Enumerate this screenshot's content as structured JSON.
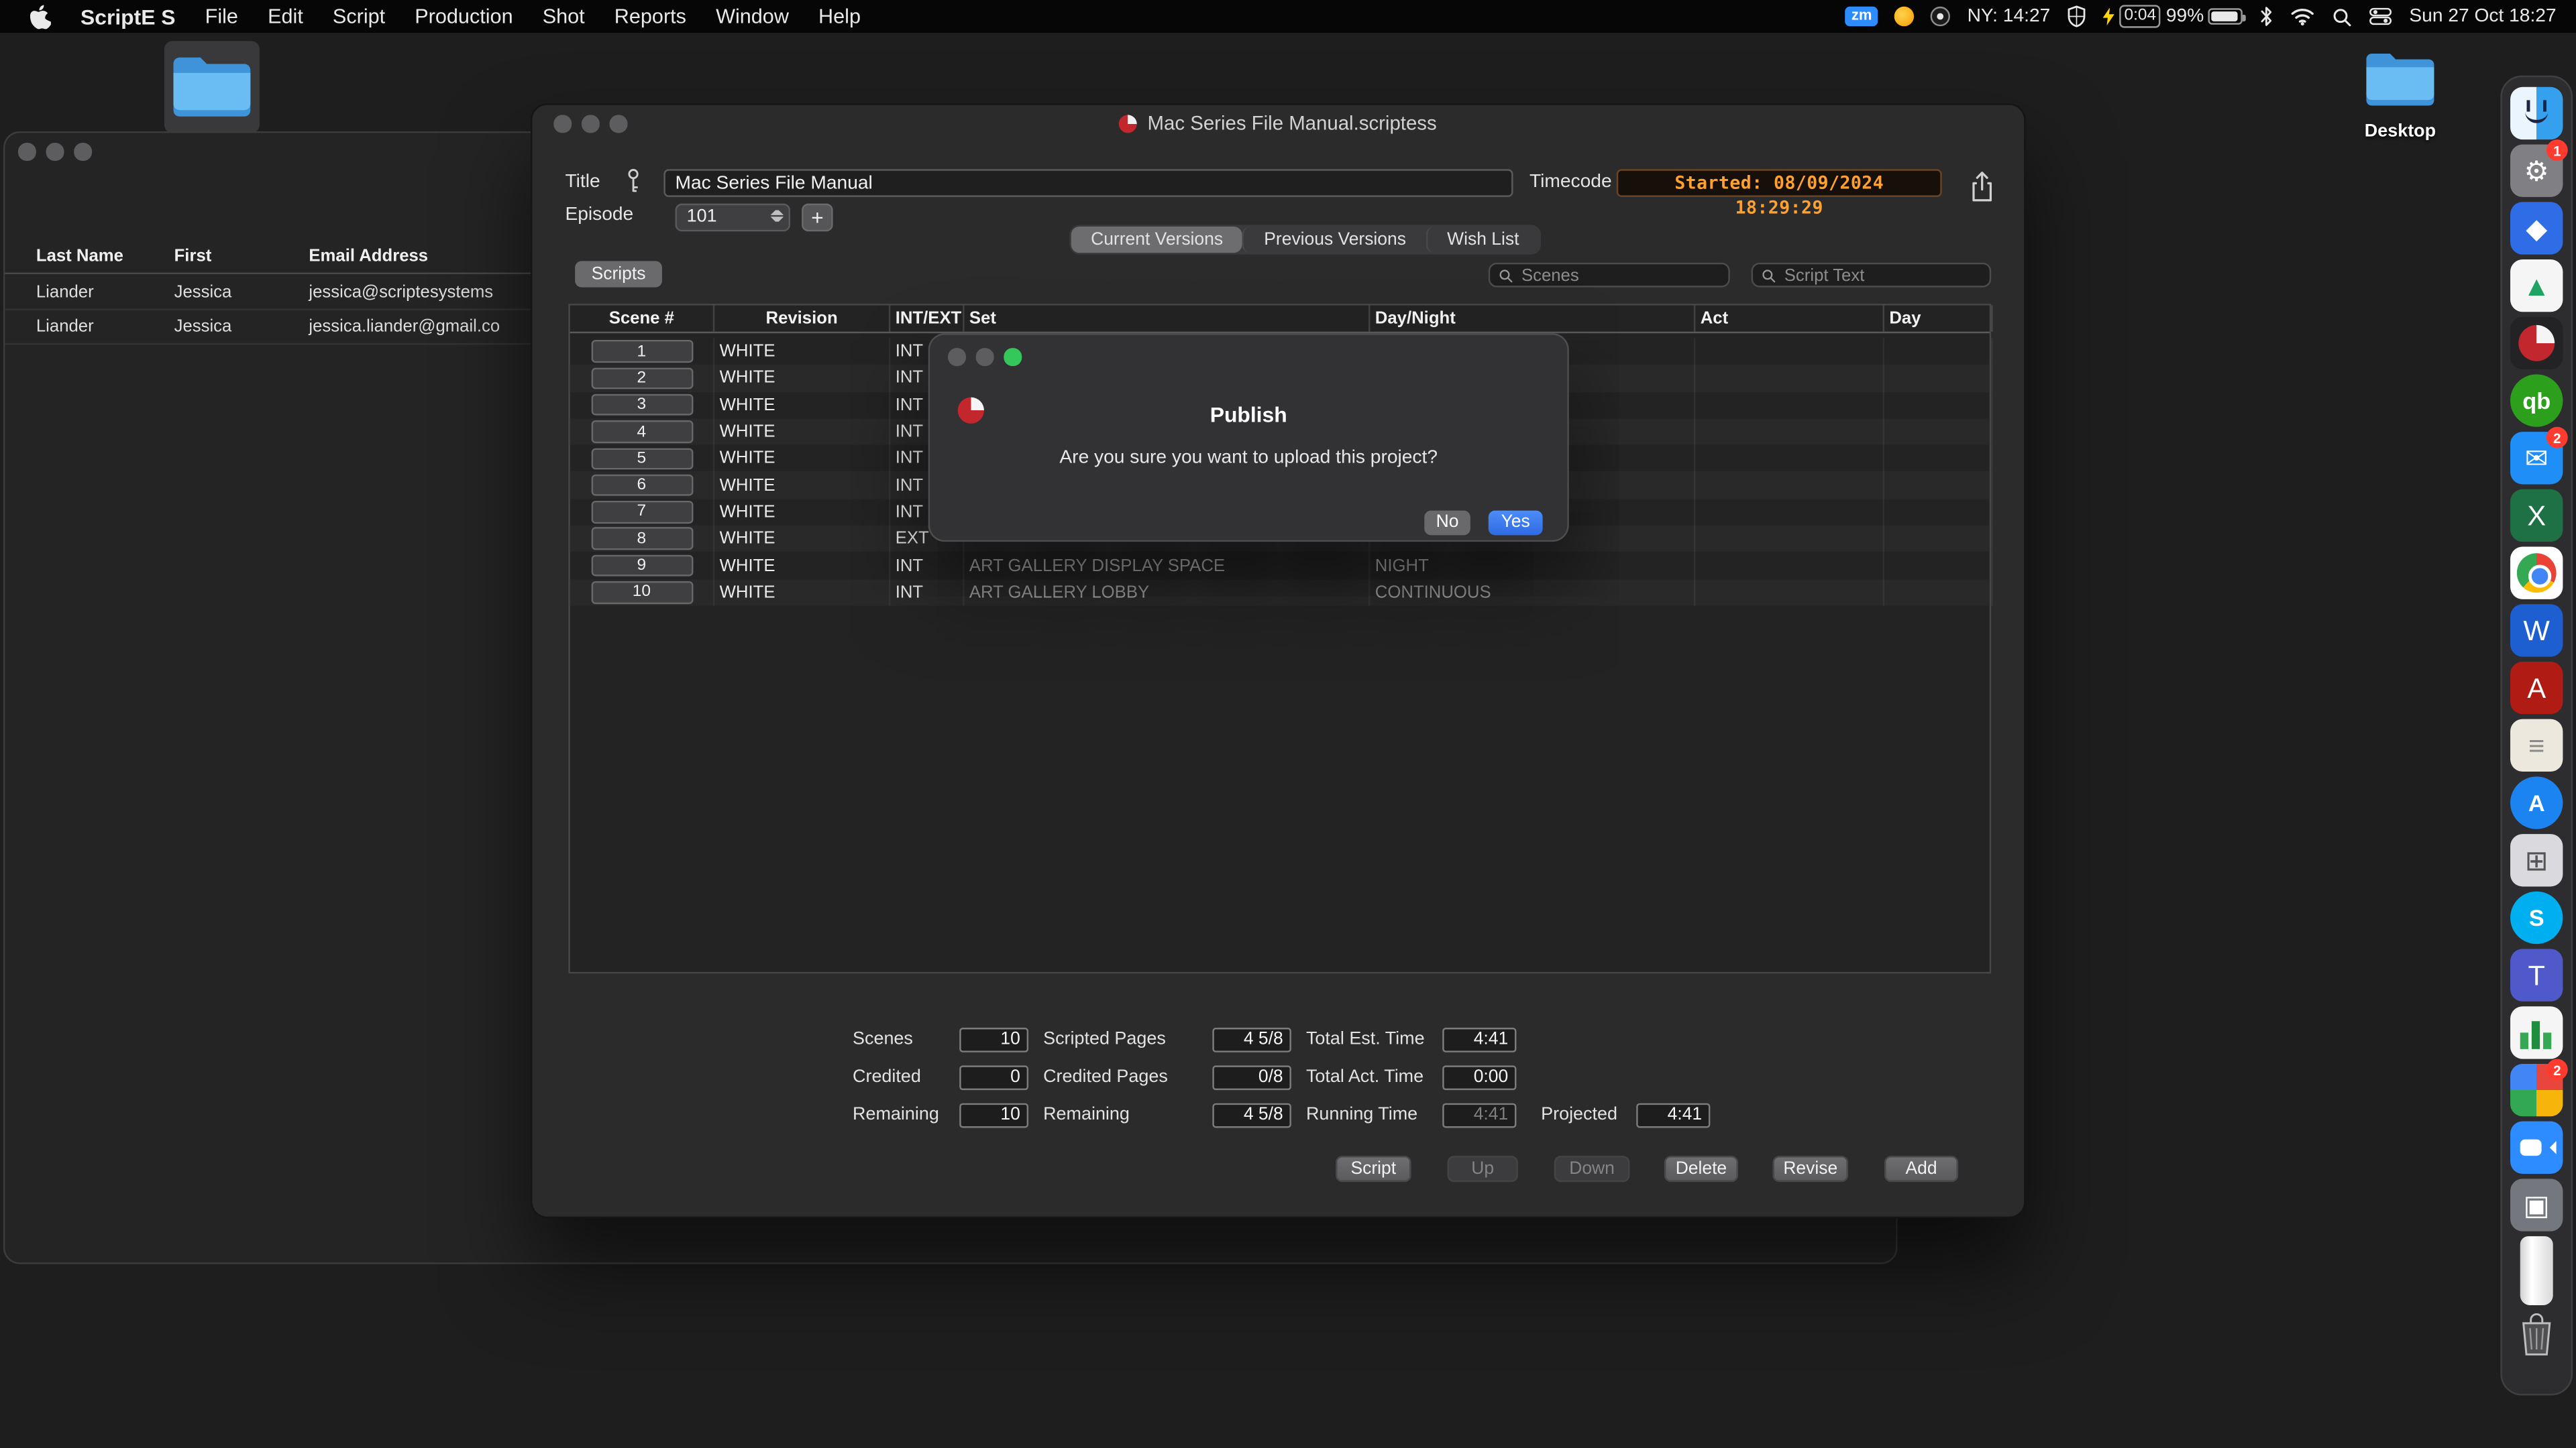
{
  "menu_bar": {
    "app_name": "ScriptE S",
    "menus": [
      "File",
      "Edit",
      "Script",
      "Production",
      "Shot",
      "Reports",
      "Window",
      "Help"
    ],
    "status": {
      "zoom_badge": "zm",
      "ny_time": "NY: 14:27",
      "battery_time": "0:04",
      "battery_percent": "99%",
      "clock": "Sun 27 Oct 18:27"
    }
  },
  "desktop": {
    "desktop_folder_label": "Desktop"
  },
  "contacts_window": {
    "columns": [
      "Last Name",
      "First",
      "Email Address"
    ],
    "rows": [
      {
        "last_name": "Liander",
        "first": "Jessica",
        "email": "jessica@scriptesystems"
      },
      {
        "last_name": "Liander",
        "first": "Jessica",
        "email": "jessica.liander@gmail.co"
      }
    ]
  },
  "main_window": {
    "window_title": "Mac Series File Manual.scriptess",
    "title_label": "Title",
    "title_value": "Mac Series File Manual",
    "timecode_label": "Timecode",
    "timecode_value": "Started: 08/09/2024 18:29:29",
    "episode_label": "Episode",
    "episode_value": "101",
    "add_episode_label": "+",
    "scripts_tab_label": "Scripts",
    "search_scenes_placeholder": "Scenes",
    "search_text_placeholder": "Script Text",
    "tabs": [
      {
        "label": "Current Versions",
        "selected": true
      },
      {
        "label": "Previous Versions",
        "selected": false
      },
      {
        "label": "Wish List",
        "selected": false
      }
    ],
    "table": {
      "columns": [
        "Scene #",
        "Revision",
        "INT/EXT",
        "Set",
        "Day/Night",
        "Act",
        "Day"
      ],
      "rows": [
        {
          "scene": "1",
          "revision": "WHITE",
          "int_ext": "INT",
          "set": "",
          "day_night": "",
          "act": "",
          "day": ""
        },
        {
          "scene": "2",
          "revision": "WHITE",
          "int_ext": "INT",
          "set": "",
          "day_night": "",
          "act": "",
          "day": ""
        },
        {
          "scene": "3",
          "revision": "WHITE",
          "int_ext": "INT",
          "set": "",
          "day_night": "",
          "act": "",
          "day": ""
        },
        {
          "scene": "4",
          "revision": "WHITE",
          "int_ext": "INT",
          "set": "",
          "day_night": "",
          "act": "",
          "day": ""
        },
        {
          "scene": "5",
          "revision": "WHITE",
          "int_ext": "INT",
          "set": "",
          "day_night": "",
          "act": "",
          "day": ""
        },
        {
          "scene": "6",
          "revision": "WHITE",
          "int_ext": "INT",
          "set": "",
          "day_night": "",
          "act": "",
          "day": ""
        },
        {
          "scene": "7",
          "revision": "WHITE",
          "int_ext": "INT",
          "set": "",
          "day_night": "",
          "act": "",
          "day": ""
        },
        {
          "scene": "8",
          "revision": "WHITE",
          "int_ext": "EXT",
          "set": "",
          "day_night": "",
          "act": "",
          "day": ""
        },
        {
          "scene": "9",
          "revision": "WHITE",
          "int_ext": "INT",
          "set": "ART GALLERY DISPLAY SPACE",
          "day_night": "NIGHT",
          "act": "",
          "day": ""
        },
        {
          "scene": "10",
          "revision": "WHITE",
          "int_ext": "INT",
          "set": "ART GALLERY LOBBY",
          "day_night": "CONTINUOUS",
          "act": "",
          "day": ""
        }
      ]
    },
    "stats": {
      "scenes": {
        "label": "Scenes",
        "value": "10"
      },
      "scripted_pages": {
        "label": "Scripted Pages",
        "value": "4 5/8"
      },
      "total_est_time": {
        "label": "Total Est. Time",
        "value": "4:41"
      },
      "credited": {
        "label": "Credited",
        "value": "0"
      },
      "credited_pages": {
        "label": "Credited Pages",
        "value": "0/8"
      },
      "total_act_time": {
        "label": "Total Act. Time",
        "value": "0:00"
      },
      "remaining": {
        "label": "Remaining",
        "value": "10"
      },
      "remaining_pages": {
        "label": "Remaining",
        "value": "4 5/8"
      },
      "running_time": {
        "label": "Running Time",
        "value": "4:41"
      },
      "projected": {
        "label": "Projected",
        "value": "4:41"
      }
    },
    "buttons": {
      "script": "Script",
      "up": "Up",
      "down": "Down",
      "delete": "Delete",
      "revise": "Revise",
      "add": "Add"
    }
  },
  "dialog": {
    "title": "Publish",
    "message": "Are you sure you want to upload this project?",
    "no_label": "No",
    "yes_label": "Yes"
  },
  "dock": {
    "items": [
      {
        "name": "finder",
        "kind": "finder"
      },
      {
        "name": "system-settings",
        "kind": "glyph",
        "glyph": "⚙",
        "bg": "#7f7f84",
        "badge": "1"
      },
      {
        "name": "blue-utility",
        "kind": "glyph",
        "glyph": "◆",
        "bg": "#2e6de5"
      },
      {
        "name": "google-drive",
        "kind": "glyph",
        "glyph": "▲",
        "bg": "#f5f5f5",
        "glyph_color": "#1ea362"
      },
      {
        "name": "scripte",
        "kind": "pie",
        "bg": "#232325"
      },
      {
        "name": "quickbooks",
        "kind": "circle",
        "glyph": "qb",
        "bg": "#2ca01c"
      },
      {
        "name": "mail",
        "kind": "glyph",
        "glyph": "✉",
        "bg": "#1f8ff7",
        "badge": "2"
      },
      {
        "name": "excel",
        "kind": "glyph",
        "glyph": "X",
        "bg": "#1e7145"
      },
      {
        "name": "chrome",
        "kind": "chrome"
      },
      {
        "name": "word",
        "kind": "glyph",
        "glyph": "W",
        "bg": "#1d5fd0"
      },
      {
        "name": "acrobat",
        "kind": "glyph",
        "glyph": "A",
        "bg": "#b01c14"
      },
      {
        "name": "notes",
        "kind": "glyph",
        "glyph": "≡",
        "bg": "#ece8dd",
        "glyph_color": "#8a8a8a"
      },
      {
        "name": "app-store",
        "kind": "circle",
        "glyph": "A",
        "bg": "#1b84f0"
      },
      {
        "name": "launchpad",
        "kind": "glyph",
        "glyph": "⊞",
        "bg": "#d9d9de",
        "glyph_color": "#555555"
      },
      {
        "name": "skype",
        "kind": "circle",
        "glyph": "S",
        "bg": "#00aff0"
      },
      {
        "name": "teams",
        "kind": "glyph",
        "glyph": "T",
        "bg": "#5059c9"
      },
      {
        "name": "numbers-chart",
        "kind": "bars",
        "bg": "#f5f5f5"
      },
      {
        "name": "office",
        "kind": "wheel",
        "badge": "2"
      },
      {
        "name": "zoom",
        "kind": "zoomcam",
        "bg": "#2d8cff"
      },
      {
        "name": "remote-desktop",
        "kind": "glyph",
        "glyph": "▣",
        "bg": "#74777e"
      },
      {
        "name": "canister",
        "kind": "jar"
      },
      {
        "name": "trash",
        "kind": "trash"
      }
    ]
  },
  "colors": {
    "accent_blue": "#3f7ef0",
    "timecode_orange": "#ffa02f",
    "badge_red": "#ff3b30"
  }
}
